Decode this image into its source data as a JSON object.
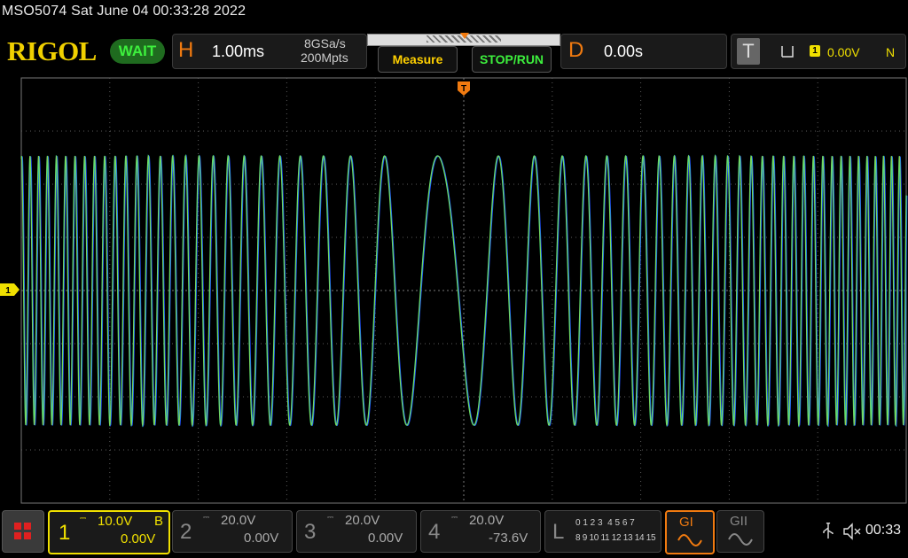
{
  "status_bar": {
    "title": "MSO5074  Sat June 04 00:33:28 2022"
  },
  "brand": {
    "logo": "RIGOL",
    "run_state": "WAIT"
  },
  "horizontal": {
    "letter": "H",
    "timebase": "1.00ms",
    "sample_rate": "8GSa/s",
    "memory_depth": "200Mpts"
  },
  "buttons": {
    "measure": "Measure",
    "stop_run": "STOP/RUN"
  },
  "delay": {
    "letter": "D",
    "value": "0.00s"
  },
  "trigger": {
    "letter": "T",
    "slope_icon": "rising-edge-icon",
    "source": "1",
    "level": "0.00V",
    "mode": "N"
  },
  "markers": {
    "trigger_marker": "T",
    "ch1_marker": "1"
  },
  "channels": [
    {
      "num": "1",
      "scale": "10.0V",
      "bw": "B",
      "offset": "0.00V",
      "color": "#f0e000"
    },
    {
      "num": "2",
      "scale": "20.0V",
      "bw": "",
      "offset": "0.00V",
      "color": "#888888"
    },
    {
      "num": "3",
      "scale": "20.0V",
      "bw": "",
      "offset": "0.00V",
      "color": "#888888"
    },
    {
      "num": "4",
      "scale": "20.0V",
      "bw": "",
      "offset": "-73.6V",
      "color": "#888888"
    }
  ],
  "logic": {
    "letter": "L",
    "row1": "0 1 2 3  4 5 6 7",
    "row2": "8 9 10 11 12 13 14 15"
  },
  "generators": [
    {
      "label": "GI",
      "active": true
    },
    {
      "label": "GII",
      "active": false
    }
  ],
  "system": {
    "usb_icon": "usb-icon",
    "sound_icon": "mute-speaker-icon",
    "time": "00:33"
  },
  "colors": {
    "accent": "#f07a10",
    "ch1": "#f0e000",
    "trace_green": "#40f080",
    "trace_blue": "#2050ff",
    "grid": "#5a5a5a",
    "logo": "#f0d000"
  }
}
